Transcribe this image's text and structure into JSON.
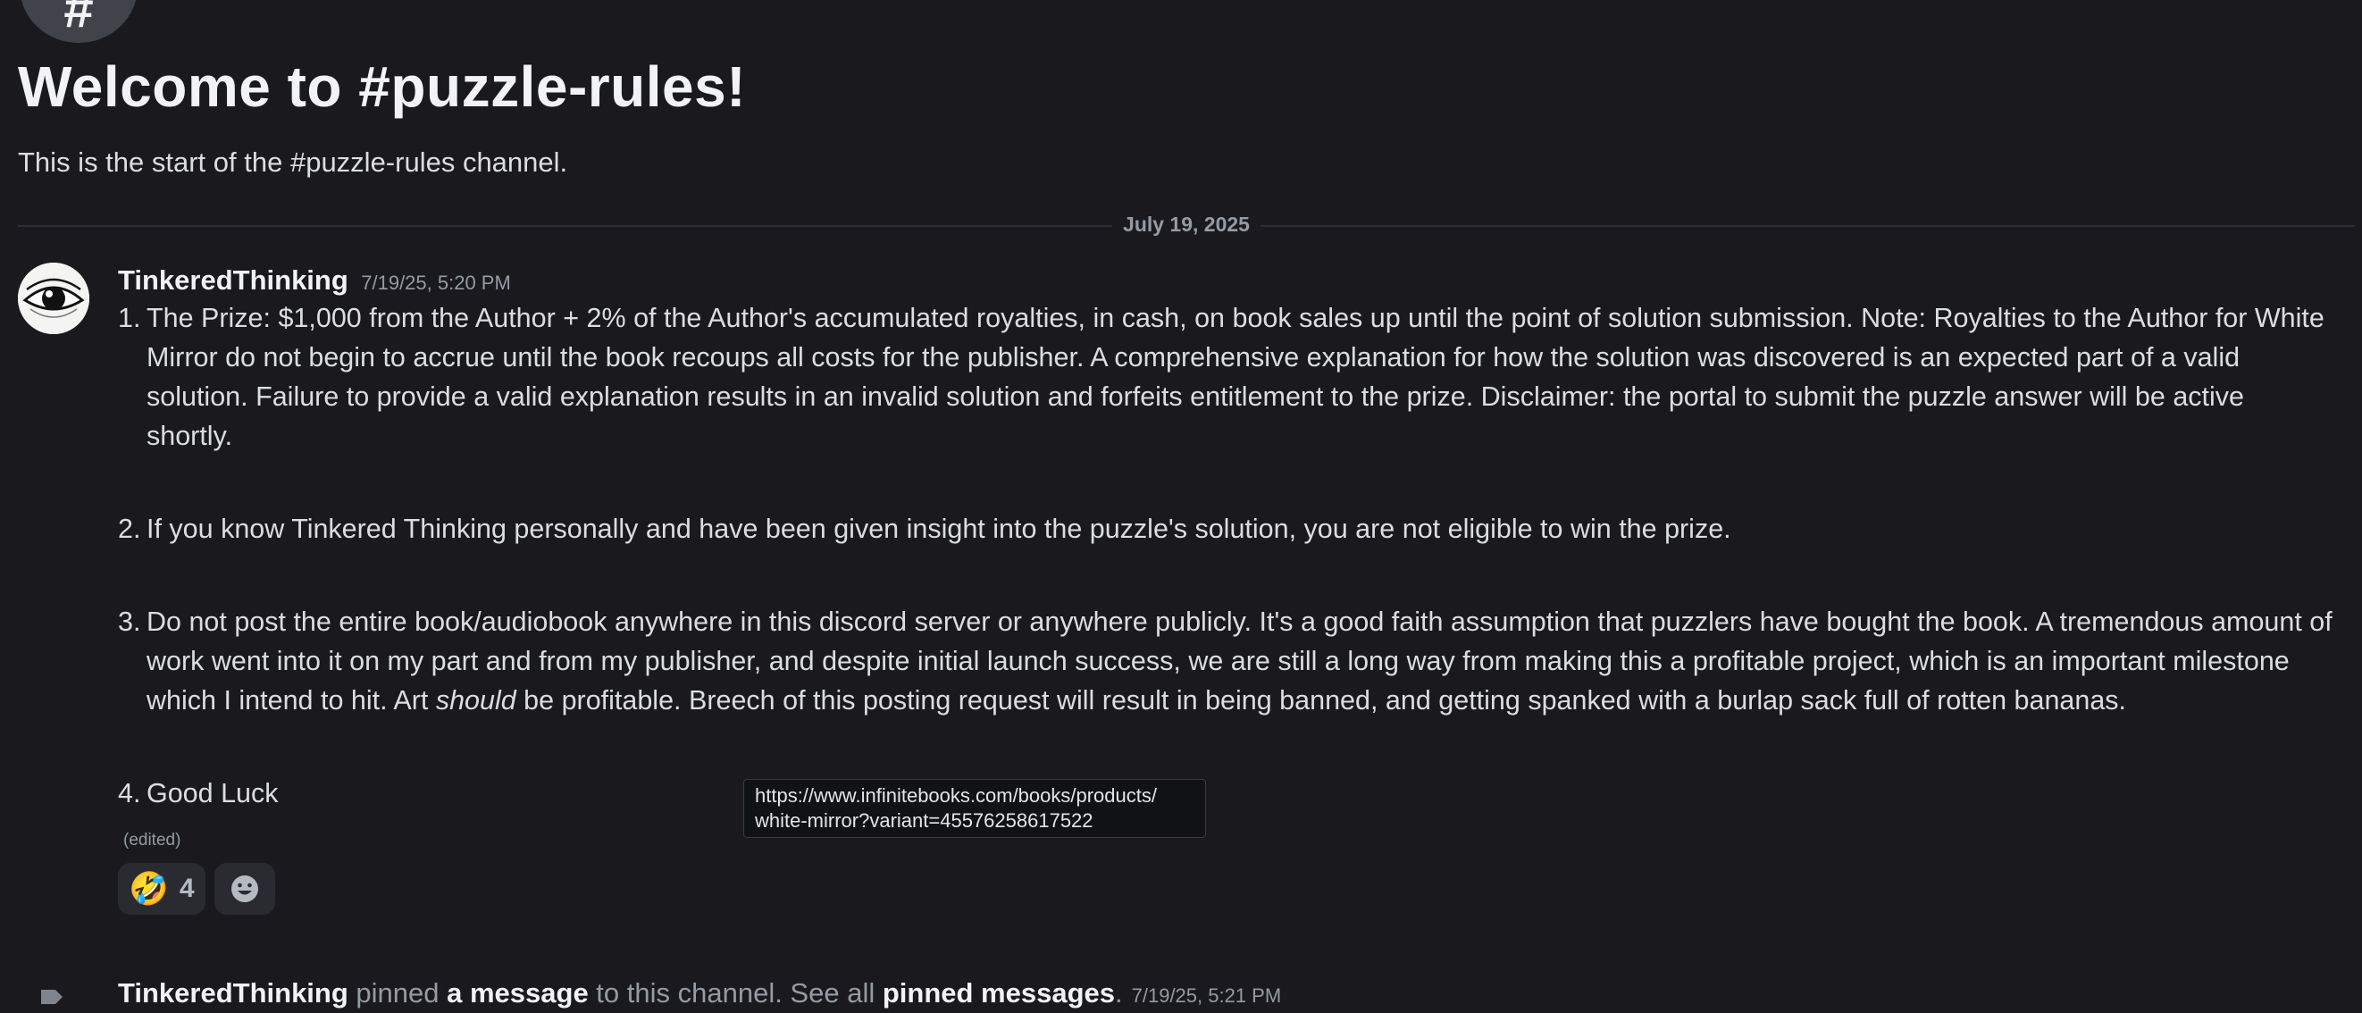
{
  "channel": {
    "icon_glyph": "#",
    "welcome_title": "Welcome to #puzzle-rules!",
    "welcome_subtitle": "This is the start of the #puzzle-rules channel."
  },
  "date_divider": "July 19, 2025",
  "message": {
    "author": "TinkeredThinking",
    "timestamp": "7/19/25, 5:20 PM",
    "avatar_icon": "eye-icon",
    "rules": [
      {
        "num": "1.",
        "text": "The Prize: $1,000 from the Author + 2% of the Author's accumulated royalties, in cash, on book sales up until the point of solution submission. Note: Royalties to the Author for White Mirror do not begin to accrue until the book recoups all costs for the publisher. A comprehensive explanation for how the solution was discovered is an expected part of a valid solution. Failure to provide a valid explanation results in an invalid solution and forfeits entitlement to the prize. Disclaimer: the portal to submit the puzzle answer will be active shortly."
      },
      {
        "num": "2.",
        "text": "If you know Tinkered Thinking personally and have been given insight into the puzzle's solution, you are not eligible to win the prize."
      },
      {
        "num": "3.",
        "text_before": "Do not post the entire book/audiobook anywhere in this discord server or anywhere publicly. It's a good faith assumption that puzzlers have bought the book. A tremendous amount of work went into it on my part and from my publisher, and despite initial launch success, we are still a long way from making this a profitable project, which is an important milestone which I intend to hit. Art ",
        "text_emphasis": "should",
        "text_after": " be profitable. Breech of this posting request will result in being banned, and getting spanked with a burlap sack full of rotten bananas."
      },
      {
        "num": "4.",
        "text": "Good Luck"
      }
    ],
    "edited_label": "(edited)",
    "reactions": [
      {
        "emoji": "🤣",
        "count": "4"
      }
    ],
    "add_reaction_icon": "smiley-icon"
  },
  "tooltip": {
    "url": "https://www.infinitebooks.com/books/products/\nwhite-mirror?variant=45576258617522"
  },
  "pin_notice": {
    "icon": "pin-icon",
    "author": "TinkeredThinking",
    "verb": " pinned ",
    "link": "a message",
    "middle": " to this channel. See all ",
    "link2": "pinned messages",
    "end": ".",
    "timestamp": "7/19/25, 5:21 PM"
  },
  "colors": {
    "background": "#1a1a1e",
    "text": "#dbdee1",
    "heading": "#f2f3f5",
    "muted": "#949ba4",
    "reaction_bg": "#2a2b31"
  }
}
